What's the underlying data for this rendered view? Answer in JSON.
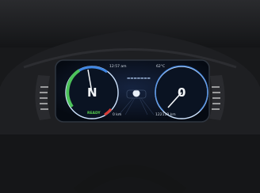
{
  "cluster": {
    "clock": "12:57 am",
    "outside_temp": "62°C",
    "gear": "N",
    "speed": "0",
    "ready_indicator": "READY",
    "left_bottom_readout": "0 km",
    "right_bottom_readout": "122119 km",
    "center_message": "▬▬▬▬▬▬▬"
  },
  "icons": [
    "ev-power-gauge-icon",
    "speedometer-icon",
    "car-icon",
    "outside-temperature-icon",
    "fuel-icon"
  ],
  "colors": {
    "dash": "#202124",
    "screen": "#0b1220",
    "gauge_ring": "#cfe4ff",
    "accent_blue": "#3f86e3",
    "ready_green": "#57d14f",
    "warn_red": "#d93b35",
    "power_arc": "#4cc25a"
  }
}
